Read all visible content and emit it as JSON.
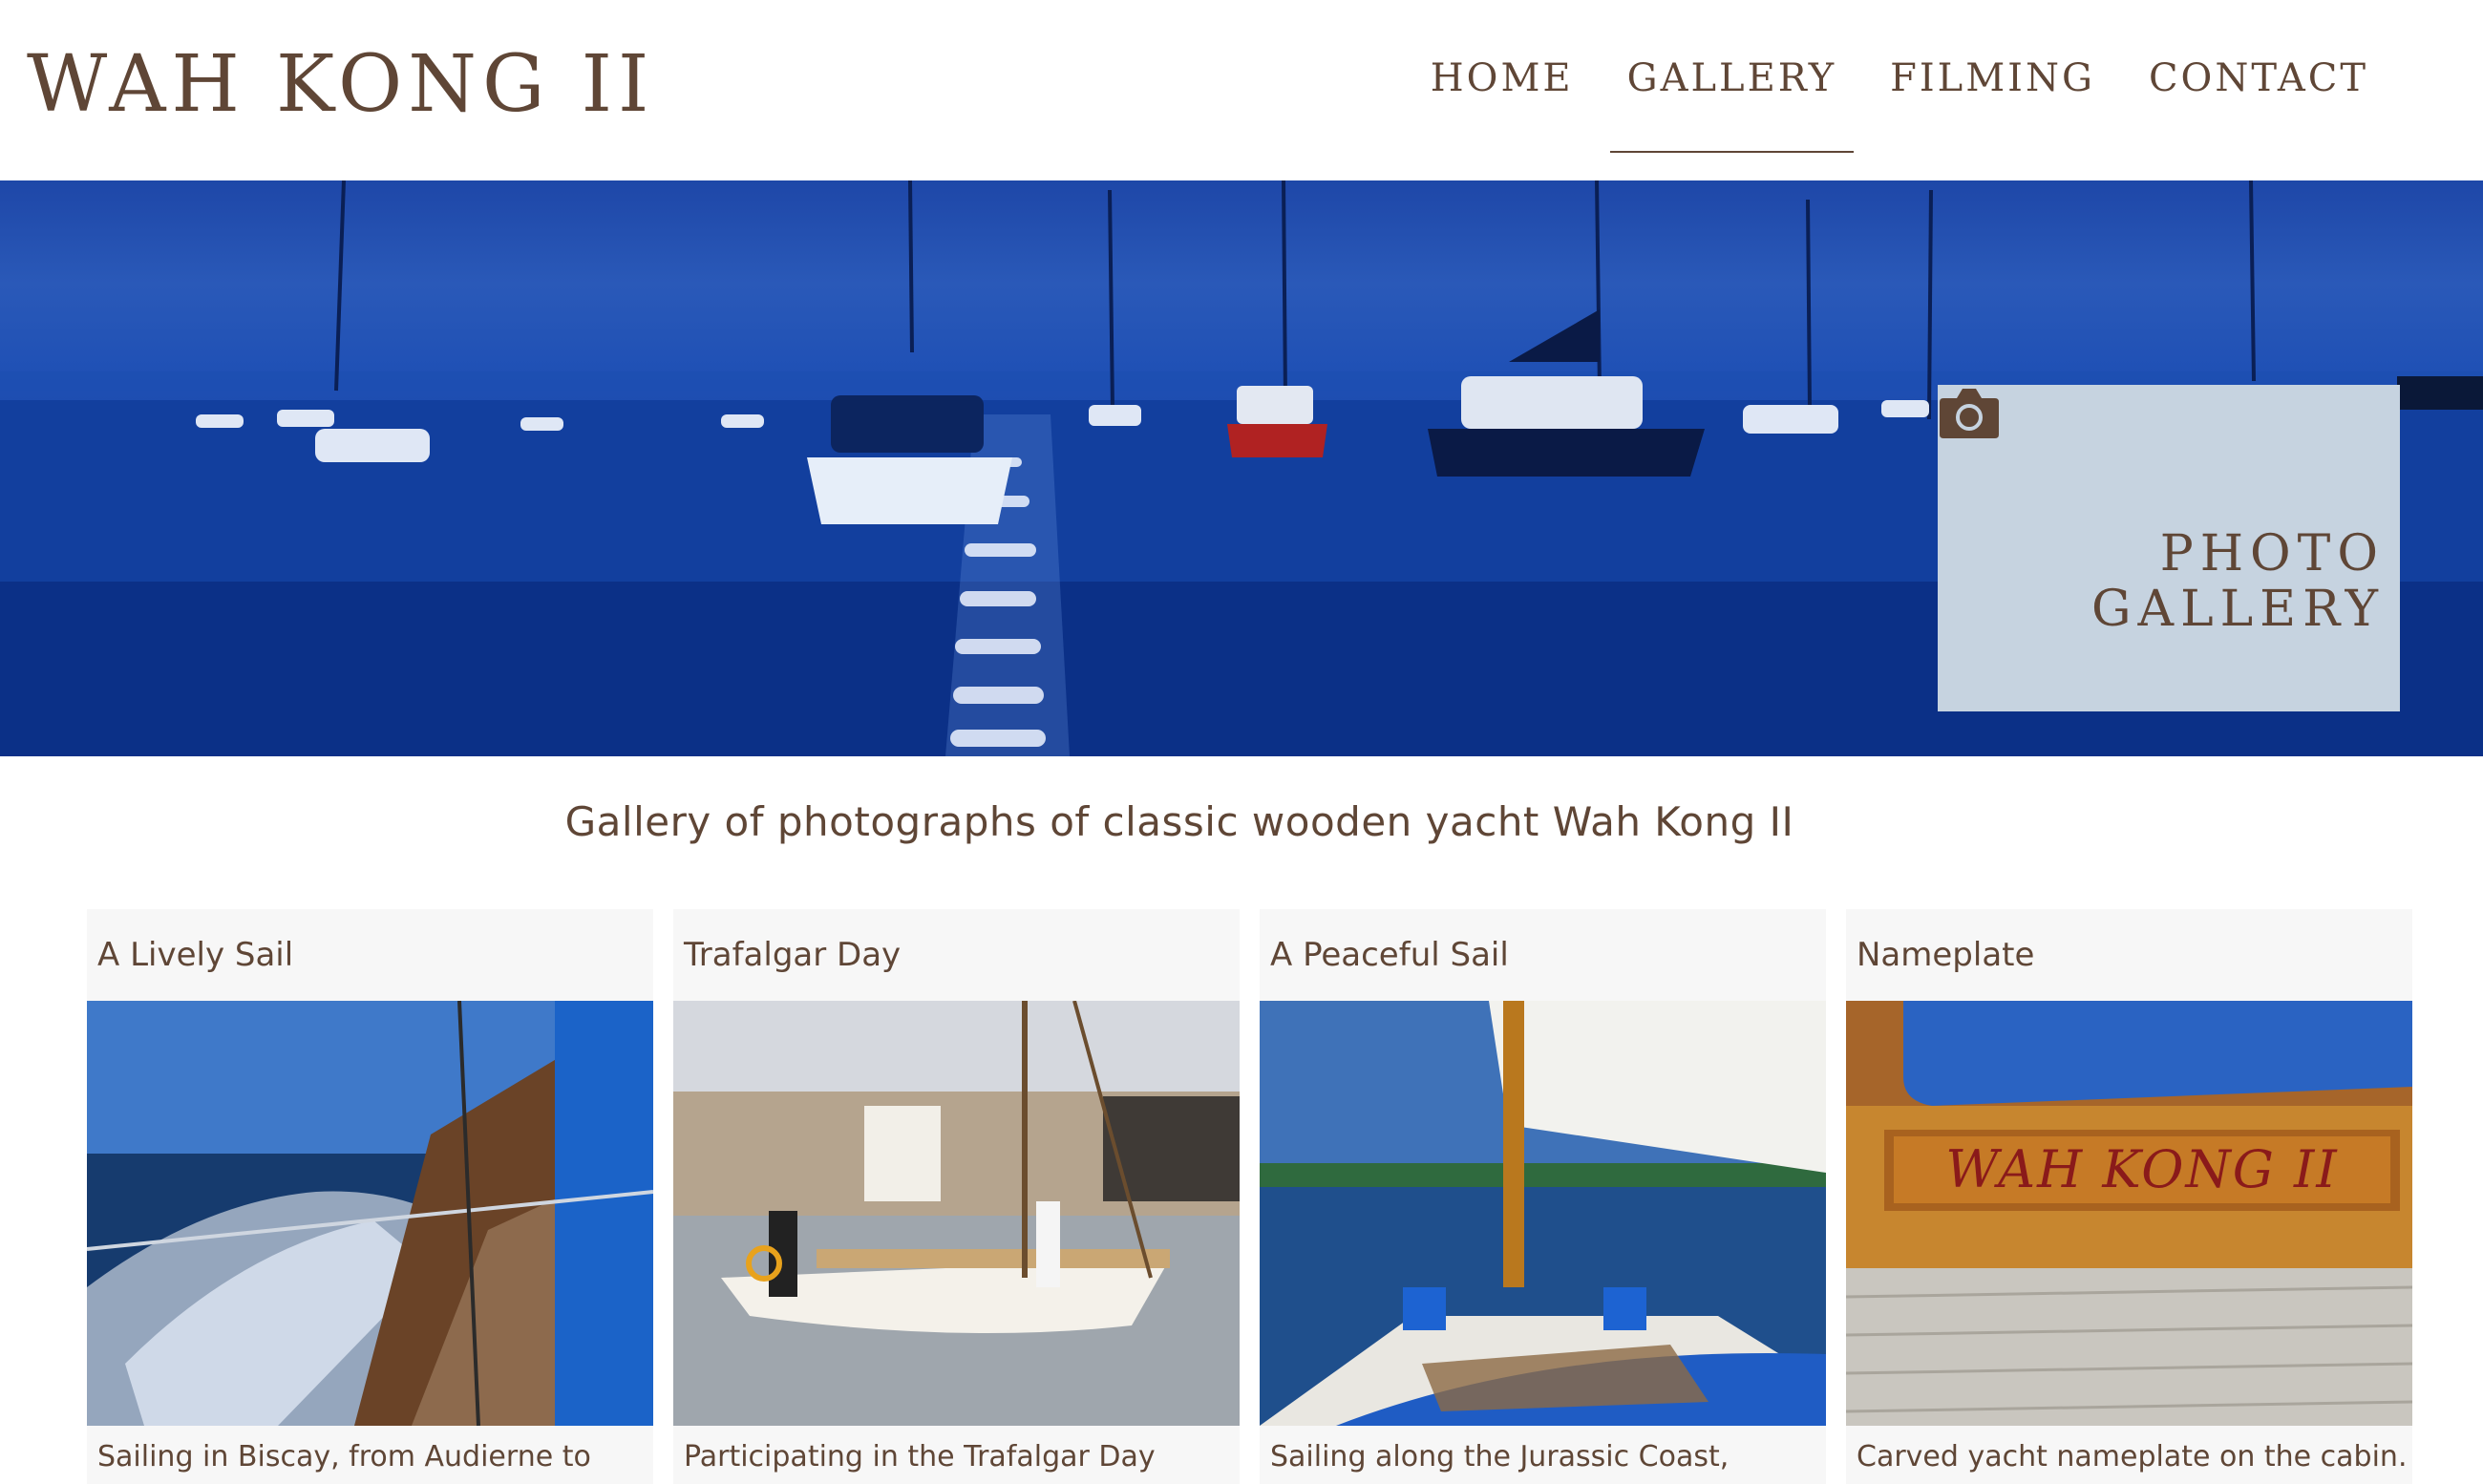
{
  "site": {
    "logo": "WAH KONG II"
  },
  "nav": {
    "items": [
      {
        "label": "HOME"
      },
      {
        "label": "GALLERY"
      },
      {
        "label": "FILMING"
      },
      {
        "label": "CONTACT"
      }
    ],
    "active": "GALLERY"
  },
  "hero": {
    "panel_line1": "PHOTO",
    "panel_line2": "GALLERY",
    "icon": "camera-icon"
  },
  "intro": {
    "text": "Gallery of photographs of classic wooden yacht Wah Kong II"
  },
  "gallery": [
    {
      "title": "A Lively Sail",
      "caption": "Sailing in Biscay, from Audierne to"
    },
    {
      "title": "Trafalgar Day",
      "caption": "Participating in the Trafalgar Day"
    },
    {
      "title": "A Peaceful Sail",
      "caption": "Sailing along the Jurassic Coast,"
    },
    {
      "title": "Nameplate",
      "caption": "Carved yacht nameplate on the cabin.",
      "nameplate_text": "WAH KONG II"
    }
  ],
  "colors": {
    "text_brown": "#5f4636",
    "hero_blue": "#1a45a5",
    "panel_bg": "#c6d3e0",
    "card_bg": "#f7f7f7"
  }
}
